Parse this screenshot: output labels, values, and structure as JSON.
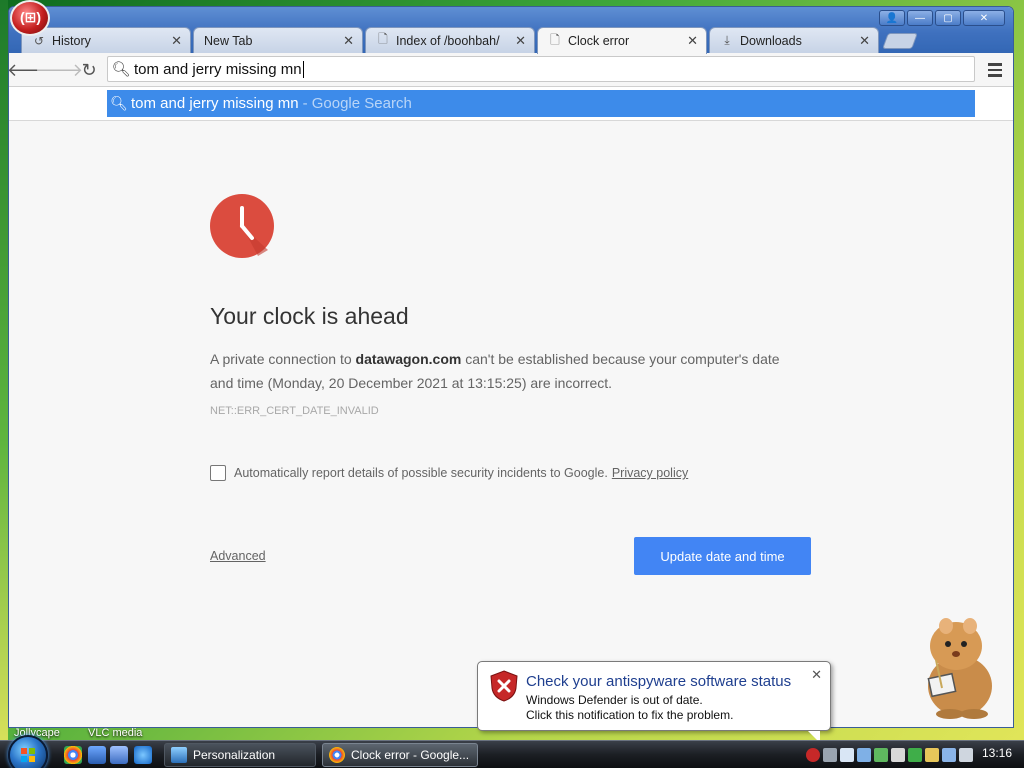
{
  "browser": {
    "tabs": [
      {
        "label": "History",
        "icon": "history-icon"
      },
      {
        "label": "New Tab",
        "icon": ""
      },
      {
        "label": "Index of /boohbah/",
        "icon": "page-icon"
      },
      {
        "label": "Clock error",
        "icon": "page-icon",
        "active": true
      },
      {
        "label": "Downloads",
        "icon": "download-icon"
      }
    ],
    "omnibox": {
      "value": "tom and jerry missing mn"
    },
    "suggestion": {
      "query": "tom and jerry missing mn",
      "hint": "- Google Search"
    }
  },
  "error_page": {
    "title": "Your clock is ahead",
    "desc_prefix": "A private connection to ",
    "domain": "datawagon.com",
    "desc_suffix": " can't be established because your computer's date and time (Monday, 20 December 2021 at 13:15:25) are incorrect.",
    "error_code": "NET::ERR_CERT_DATE_INVALID",
    "report_label": "Automatically report details of possible security incidents to Google.",
    "privacy_link": "Privacy policy",
    "advanced_link": "Advanced",
    "update_button": "Update date and time",
    "accent_color": "#db4c3f",
    "button_color": "#4285f4"
  },
  "notification": {
    "title": "Check your antispyware software status",
    "line1": "Windows Defender is out of date.",
    "line2": "Click this notification to fix the problem."
  },
  "desktop": {
    "labels": [
      "Jollycape",
      "VLC media"
    ]
  },
  "taskbar": {
    "buttons": [
      {
        "label": "Personalization"
      },
      {
        "label": "Clock error - Google..."
      }
    ],
    "clock": "13:16"
  }
}
